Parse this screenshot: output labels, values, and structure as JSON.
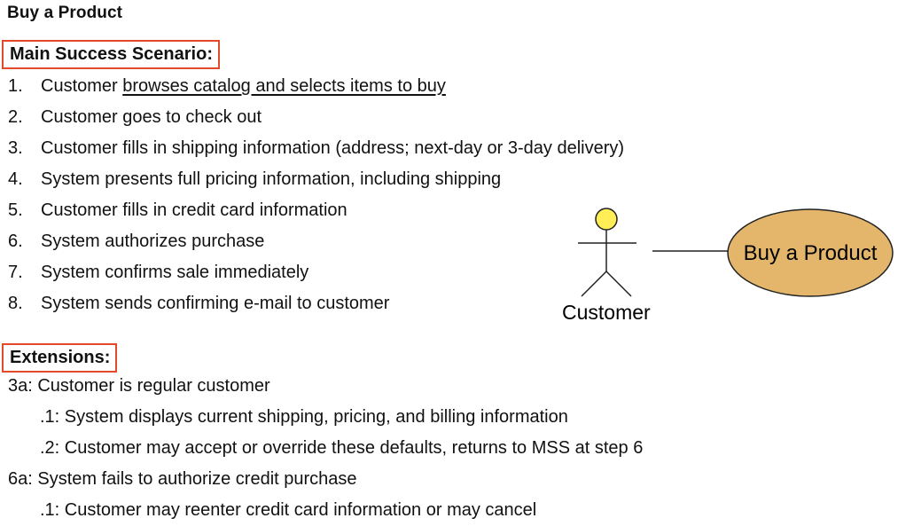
{
  "title": "Buy a Product",
  "main_success": {
    "heading": "Main Success Scenario:",
    "steps": [
      {
        "num": "1.",
        "prefix": "Customer ",
        "underlined": "browses catalog and selects items to buy"
      },
      {
        "num": "2.",
        "text": "Customer goes to check out"
      },
      {
        "num": "3.",
        "text": "Customer fills in shipping information (address; next-day or 3-day delivery)"
      },
      {
        "num": "4.",
        "text": "System presents full pricing information, including shipping"
      },
      {
        "num": "5.",
        "text": "Customer fills in credit card information"
      },
      {
        "num": "6.",
        "text": "System authorizes purchase"
      },
      {
        "num": "7.",
        "text": "System confirms sale immediately"
      },
      {
        "num": "8.",
        "text": "System sends confirming e-mail to customer"
      }
    ]
  },
  "extensions": {
    "heading": "Extensions:",
    "items": [
      {
        "text": "3a: Customer is regular customer"
      },
      {
        "text": ".1: System displays current shipping, pricing, and billing information"
      },
      {
        "text": ".2: Customer may accept or override these defaults, returns to MSS at step 6"
      },
      {
        "text": "6a: System fails to authorize credit purchase"
      },
      {
        "text": ".1: Customer may reenter credit card information or may cancel"
      }
    ]
  },
  "diagram": {
    "actor_label": "Customer",
    "usecase_label": "Buy a Product",
    "colors": {
      "actor_head": "#ffee55",
      "usecase_fill": "#e3b66b",
      "box_border": "#e24a2a"
    }
  }
}
